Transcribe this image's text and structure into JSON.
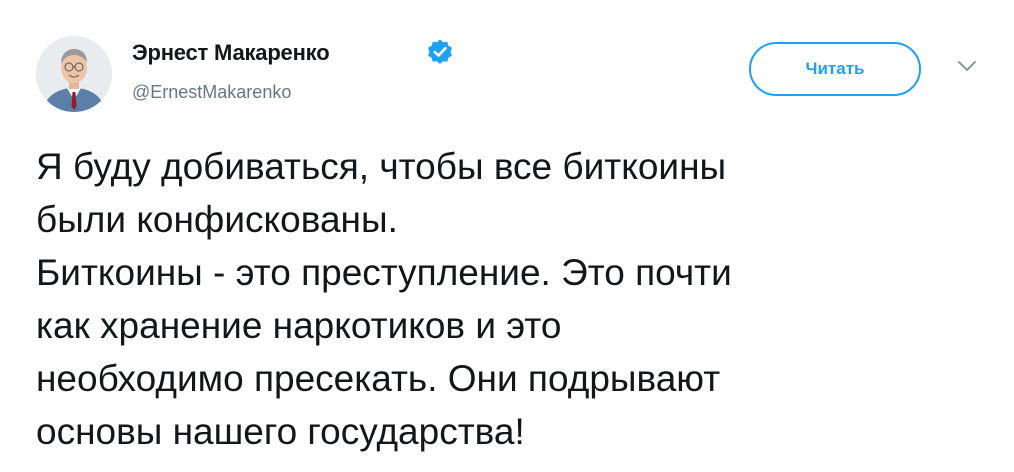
{
  "author": {
    "name": "Эрнест Макаренко",
    "handle": "@ErnestMakarenko",
    "verified": true
  },
  "actions": {
    "follow_label": "Читать",
    "menu_icon": "chevron-down-icon"
  },
  "tweet": {
    "lines": [
      "Я буду добиваться, чтобы все биткоины",
      "были конфискованы.",
      "Биткоины - это преступление. Это почти",
      "как хранение наркотиков и это",
      "необходимо пресекать. Они подрывают",
      "основы нашего государства!"
    ]
  },
  "colors": {
    "accent": "#1da1f2",
    "text": "#14171a",
    "secondary_text": "#657786",
    "background": "#ffffff"
  }
}
